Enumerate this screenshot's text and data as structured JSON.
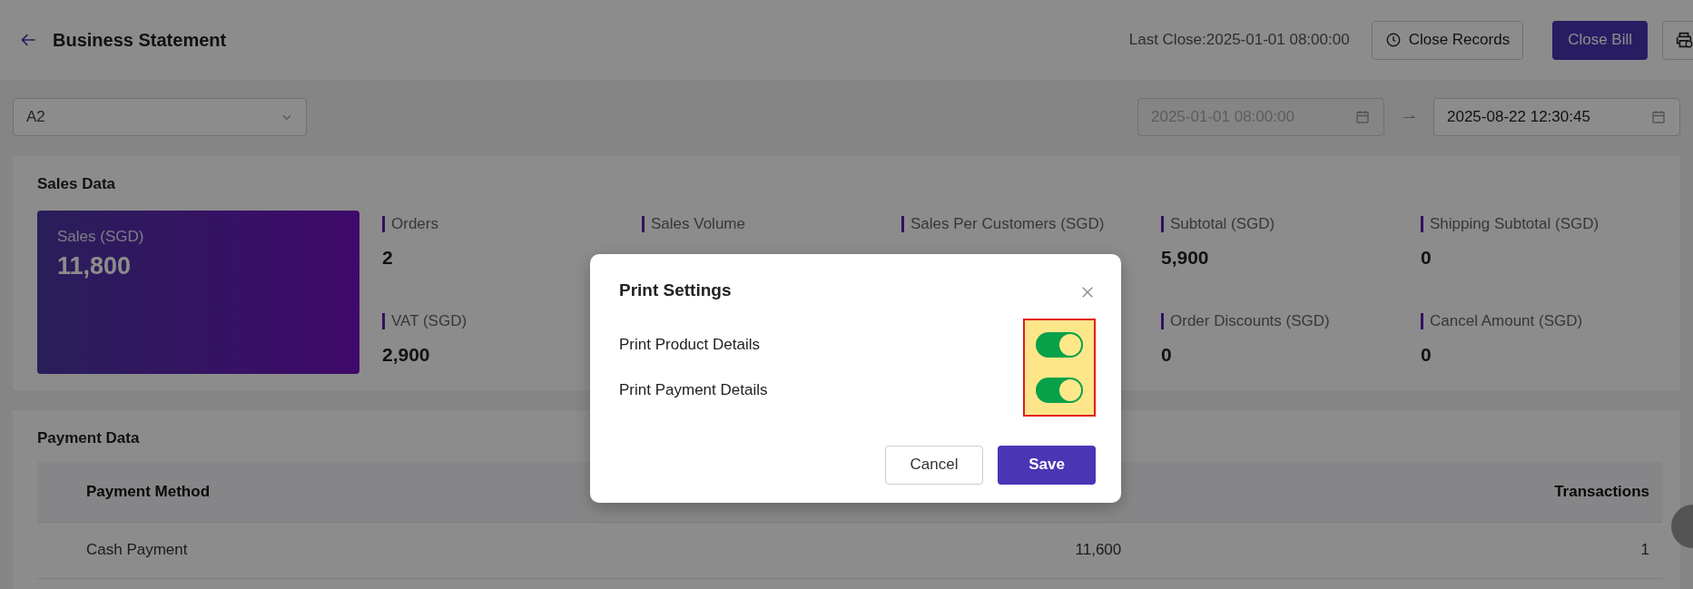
{
  "header": {
    "title": "Business Statement",
    "last_close": "Last Close:2025-01-01 08:00:00",
    "buttons": [
      {
        "kind": "outline",
        "label": "Close Records"
      },
      {
        "kind": "primary",
        "label": "Close Bill"
      },
      {
        "kind": "icon"
      }
    ]
  },
  "filters": {
    "store": "A2",
    "dates": [
      {
        "value": "2025-01-01 08:00:00",
        "disabled": true
      },
      {
        "value": "2025-08-22 12:30:45",
        "disabled": false
      }
    ]
  },
  "sales_data": {
    "title": "Sales Data",
    "featured": {
      "label": "Sales (SGD)",
      "value": "11,800"
    },
    "metric_rows": [
      [
        {
          "label": "Orders",
          "value": "2"
        },
        {
          "label": "Sales Volume"
        },
        {
          "label": "Sales Per Customers (SGD)"
        },
        {
          "label": "Subtotal (SGD)",
          "value": "5,900"
        },
        {
          "label": "Shipping Subtotal (SGD)",
          "value": "0"
        }
      ],
      [
        {
          "label": "VAT (SGD)",
          "value": "2,900"
        },
        null,
        null,
        {
          "label": "Order Discounts (SGD)",
          "value": "0"
        },
        {
          "label": "Cancel Amount (SGD)",
          "value": "0"
        }
      ]
    ]
  },
  "payment_data": {
    "title": "Payment Data",
    "columns": [
      {
        "label": "Payment Method"
      },
      {},
      {
        "label": "Transactions"
      }
    ],
    "rows": [
      [
        "Cash Payment",
        "11,600",
        "1"
      ]
    ]
  },
  "dialog": {
    "title": "Print Settings",
    "highlighted": true,
    "toggles": [
      {
        "label": "Print Product Details",
        "on": true
      },
      {
        "label": "Print Payment Details",
        "on": true
      }
    ],
    "buttons": [
      {
        "kind": "secondary",
        "label": "Cancel"
      },
      {
        "kind": "primary",
        "label": "Save"
      }
    ]
  }
}
